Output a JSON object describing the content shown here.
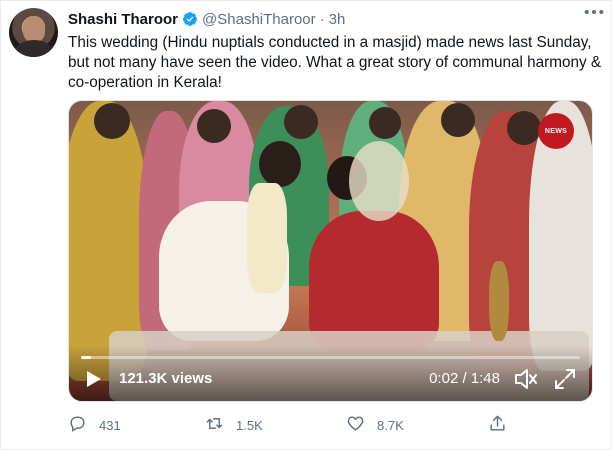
{
  "tweet": {
    "author_name": "Shashi Tharoor",
    "handle": "@ShashiTharoor",
    "separator": "·",
    "time": "3h",
    "more_icon": "more-horizontal-icon",
    "text": "This wedding (Hindu nuptials conducted in a masjid) made news last Sunday, but not many have seen the video. What a great story of communal harmony & co-operation in Kerala!"
  },
  "video": {
    "badge": "NEWS",
    "views": "121.3K views",
    "time": "0:02 / 1:48",
    "progress_fraction": 0.02
  },
  "actions": {
    "replies": "431",
    "retweets": "1.5K",
    "likes": "8.7K"
  },
  "colors": {
    "verified": "#1da1f2",
    "secondary_text": "#5b7083",
    "news_badge": "#c0191f"
  }
}
